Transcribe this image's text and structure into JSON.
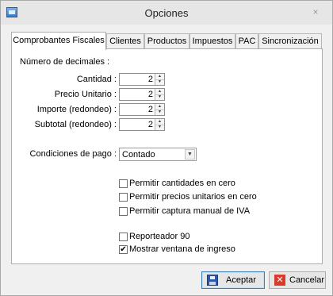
{
  "window": {
    "title": "Opciones",
    "icon": "app-window-icon",
    "close_label": "×"
  },
  "tabs": [
    {
      "label": "Comprobantes Fiscales",
      "active": true
    },
    {
      "label": "Clientes"
    },
    {
      "label": "Productos"
    },
    {
      "label": "Impuestos"
    },
    {
      "label": "PAC"
    },
    {
      "label": "Sincronización"
    }
  ],
  "form": {
    "decimals_heading": "Número de decimales :",
    "decimals": [
      {
        "label": "Cantidad :",
        "value": "2"
      },
      {
        "label": "Precio Unitario :",
        "value": "2"
      },
      {
        "label": "Importe (redondeo) :",
        "value": "2"
      },
      {
        "label": "Subtotal (redondeo) :",
        "value": "2"
      }
    ],
    "payment_label": "Condiciones de pago :",
    "payment_value": "Contado",
    "checkboxes": [
      {
        "label": "Permitir cantidades en cero",
        "checked": false
      },
      {
        "label": "Permitir precios unitarios en cero",
        "checked": false
      },
      {
        "label": "Permitir captura manual de IVA",
        "checked": false
      },
      {
        "label": "Reporteador 90",
        "checked": false
      },
      {
        "label": "Mostrar ventana de ingreso",
        "checked": true
      }
    ],
    "check_mark": "✔"
  },
  "buttons": {
    "accept_label": "Aceptar",
    "cancel_label": "Cancelar",
    "cancel_glyph": "✕"
  },
  "glyphs": {
    "spin_up": "▲",
    "spin_down": "▼",
    "dropdown": "▼"
  },
  "colors": {
    "accent_border": "#3c7fb1",
    "cancel_icon": "#d93a2b",
    "save_icon": "#2d5aa8"
  }
}
